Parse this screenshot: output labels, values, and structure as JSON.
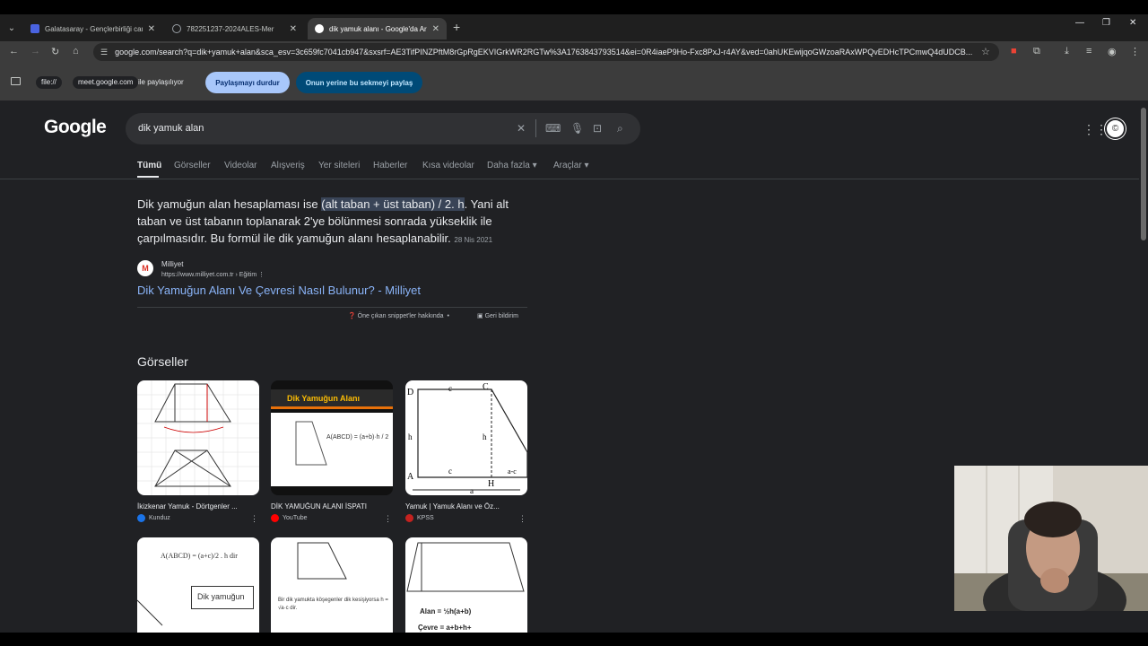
{
  "tabs": [
    {
      "title": "Galatasaray - Gençlerbirliği can",
      "active": false,
      "favicon_color": "#4a63e0"
    },
    {
      "title": "782251237-2024ALES-Mer",
      "active": false,
      "favicon_color": "#3c4043"
    },
    {
      "title": "dik yamuk alanı - Google'da Ara",
      "active": true,
      "favicon_color": "#34a853"
    }
  ],
  "address_bar": {
    "url": "google.com/search?q=dik+yamuk+alan&sca_esv=3c659fc7041cb947&sxsrf=AE3TifPINZPftM8rGpRgEKVIGrkWR2RGTw%3A1763843793514&ei=0R4iaeP9Ho-Fxc8PxJ-r4AY&ved=0ahUKEwijqoGWzoaRAxWPQvEDHcTPCmwQ4dUDCB..."
  },
  "share_bar": {
    "chip1": "file://",
    "chip2": "meet.google.com",
    "text": "ile paylaşılıyor",
    "stop_label": "Paylaşmayı durdur",
    "share_tab_label": "Onun yerine bu sekmeyi paylaş"
  },
  "google": {
    "logo": "Google",
    "query": "dik yamuk alan",
    "nav": [
      "Tümü",
      "Görseller",
      "Videolar",
      "Alışveriş",
      "Yer siteleri",
      "Haberler",
      "Kısa videolar",
      "Daha fazla",
      "Araçlar"
    ]
  },
  "snippet": {
    "pre": "Dik yamuğun alan hesaplaması ise ",
    "highlight": "(alt taban + üst taban) / 2. h",
    "post": ". Yani alt taban ve üst tabanın toplanarak 2'ye bölünmesi sonrada yükseklik ile çarpılmasıdır. Bu formül ile dik yamuğun alanı hesaplanabilir.",
    "date": "28 Nis 2021",
    "source_name": "Milliyet",
    "source_url": "https://www.milliyet.com.tr › Eğitim",
    "link_title": "Dik Yamuğun Alanı Ve Çevresi Nasıl Bulunur? - Milliyet",
    "about_label": "Öne çıkan snippet'ler hakkında",
    "feedback_label": "Geri bildirim"
  },
  "images": {
    "heading": "Görseller",
    "items": [
      {
        "title": "İkizkenar Yamuk - Dörtgenler ...",
        "source": "Kunduz",
        "source_color": "#1a73e8"
      },
      {
        "title": "DİK YAMUĞUN ALANI İSPATI",
        "source": "YouTube",
        "source_color": "#ff0000",
        "thumb_text": "Dik Yamuğun Alanı",
        "formula": "A(ABCD) = (a+b)·h / 2"
      },
      {
        "title": "Yamuk | Yamuk Alanı ve Öz...",
        "source": "KPSS",
        "source_color": "#c5221f"
      },
      {
        "title": "",
        "source": "",
        "formula": "A(ABCD) = (a+c)/2 . h dir",
        "thumb_text": "Dik yamuğun"
      },
      {
        "title": "",
        "source": "",
        "thumb_text": "Bir dik yamukta köşegenler dik kesişiyorsa h = √a·c dir."
      },
      {
        "title": "",
        "source": "",
        "thumb_text": "Alan = ½h(a+b)",
        "thumb_text2": "Çevre = a+b+h+"
      }
    ]
  }
}
